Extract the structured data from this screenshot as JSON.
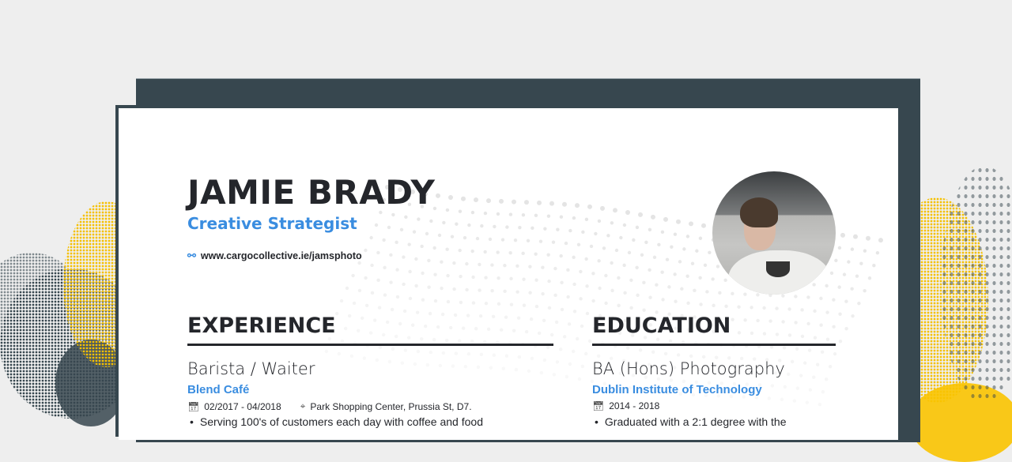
{
  "resume": {
    "name": "JAMIE BRADY",
    "title": "Creative Strategist",
    "website": "www.cargocollective.ie/jamsphoto",
    "icons": {
      "website": "link-icon",
      "date": "calendar-icon",
      "location": "map-pin-icon"
    },
    "accent_color": "#3a8de0",
    "panel_color": "#37474f",
    "highlight_color": "#f9c300"
  },
  "experience": {
    "heading": "EXPERIENCE",
    "items": [
      {
        "role": "Barista / Waiter",
        "company": "Blend Café",
        "dates": "02/2017 - 04/2018",
        "location": "Park Shopping Center, Prussia St, D7.",
        "bullets": [
          "Serving 100's of customers each day with coffee and food"
        ]
      }
    ]
  },
  "education": {
    "heading": "EDUCATION",
    "items": [
      {
        "degree": "BA (Hons) Photography",
        "school": "Dublin Institute of Technology",
        "dates": "2014 - 2018",
        "bullets": [
          "Graduated with a 2:1 degree with the"
        ]
      }
    ]
  }
}
